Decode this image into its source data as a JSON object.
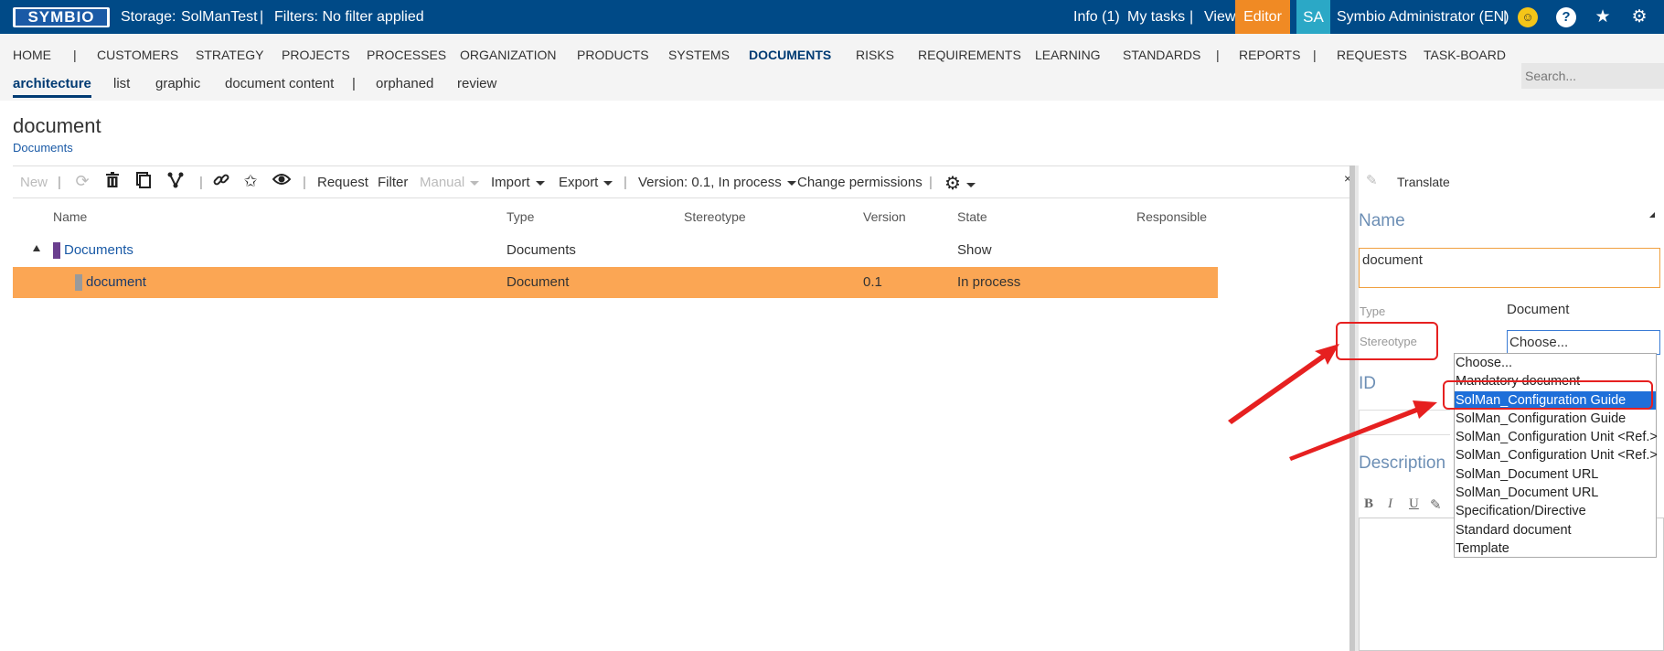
{
  "topbar": {
    "logo": "SYMBIO",
    "storage_label": "Storage:",
    "storage_value": "SolManTest",
    "divider": "|",
    "filters": "Filters: No filter applied",
    "info": "Info (1)",
    "my_tasks": "My tasks",
    "view_label": "View:",
    "view_value": "Editor",
    "avatar": "SA",
    "user": "Symbio Administrator (EN)",
    "smile_icon": "☺",
    "help_icon": "?",
    "star_icon": "★",
    "gear_icon": "⚙"
  },
  "nav": {
    "items": [
      "HOME",
      "CUSTOMERS",
      "STRATEGY",
      "PROJECTS",
      "PROCESSES",
      "ORGANIZATION",
      "PRODUCTS",
      "SYSTEMS",
      "DOCUMENTS",
      "RISKS",
      "REQUIREMENTS",
      "LEARNING",
      "STANDARDS",
      "REPORTS",
      "REQUESTS",
      "TASK-BOARD"
    ],
    "separator": "|",
    "sub": [
      "architecture",
      "list",
      "graphic",
      "document content",
      "orphaned",
      "review"
    ],
    "search_placeholder": "Search..."
  },
  "page": {
    "title": "document",
    "breadcrumb": "Documents"
  },
  "toolbar": {
    "new": "New",
    "request": "Request",
    "filter": "Filter",
    "manual": "Manual",
    "import": "Import",
    "export": "Export",
    "version": "Version: 0.1, In process",
    "change_permissions": "Change permissions",
    "close": "×"
  },
  "table": {
    "headers": [
      "Name",
      "Type",
      "Stereotype",
      "Version",
      "State",
      "Responsible"
    ],
    "rows": [
      {
        "name": "Documents",
        "type": "Documents",
        "stereotype": "",
        "version": "",
        "state": "Show",
        "responsible": ""
      },
      {
        "name": "document",
        "type": "Document",
        "stereotype": "",
        "version": "0.1",
        "state": "In process",
        "responsible": ""
      }
    ]
  },
  "panel": {
    "translate": "Translate",
    "name_label": "Name",
    "name_value": "document",
    "type_label": "Type",
    "type_value": "Document",
    "stereotype_label": "Stereotype",
    "stereotype_value": "Choose...",
    "id_label": "ID",
    "description_label": "Description",
    "format_bold": "B",
    "format_italic": "I",
    "format_underline": "U",
    "stereotype_options": [
      "Choose...",
      "Mandatory document",
      "SolMan_Configuration Guide",
      "SolMan_Configuration Guide",
      "SolMan_Configuration Unit <Ref.>",
      "SolMan_Configuration Unit <Ref.>",
      "SolMan_Document URL",
      "SolMan_Document URL",
      "Specification/Directive",
      "Standard document",
      "Template"
    ],
    "highlighted_option_index": 2
  },
  "colors": {
    "topbar": "#004a87",
    "editor": "#f08a24",
    "selected_row": "#fba654",
    "annotation": "#e62020"
  }
}
